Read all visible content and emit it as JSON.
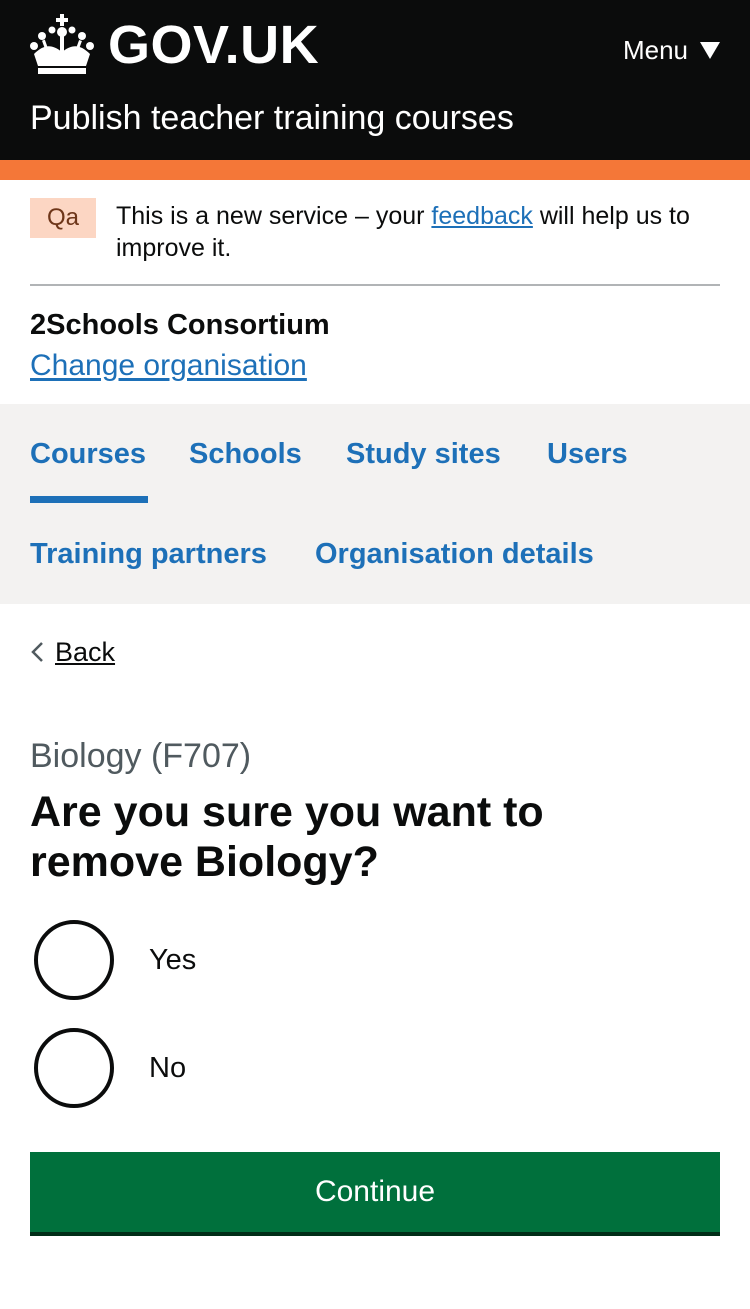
{
  "header": {
    "logo_text": "GOV.UK",
    "menu_label": "Menu",
    "service_name": "Publish teacher training courses"
  },
  "phase_banner": {
    "tag": "Qa",
    "text_before": "This is a new service – your ",
    "link": "feedback",
    "text_after": " will help us to improve it."
  },
  "organisation": {
    "name": "2Schools Consortium",
    "change_link": "Change organisation"
  },
  "nav": {
    "items": [
      {
        "label": "Courses",
        "active": true
      },
      {
        "label": "Schools"
      },
      {
        "label": "Study sites"
      },
      {
        "label": "Users"
      },
      {
        "label": "Training partners"
      },
      {
        "label": "Organisation details"
      }
    ]
  },
  "back_link": "Back",
  "content": {
    "caption": "Biology (F707)",
    "heading": "Are you sure you want to remove Biology?",
    "options": [
      {
        "label": "Yes",
        "checked": false
      },
      {
        "label": "No",
        "checked": false
      }
    ],
    "continue_label": "Continue"
  },
  "colors": {
    "header_bg": "#0b0c0c",
    "accent_bar": "#f47738",
    "link": "#1d70b8",
    "nav_bg": "#f3f2f1",
    "tag_bg": "#fcd6c3",
    "button_bg": "#00703c"
  }
}
